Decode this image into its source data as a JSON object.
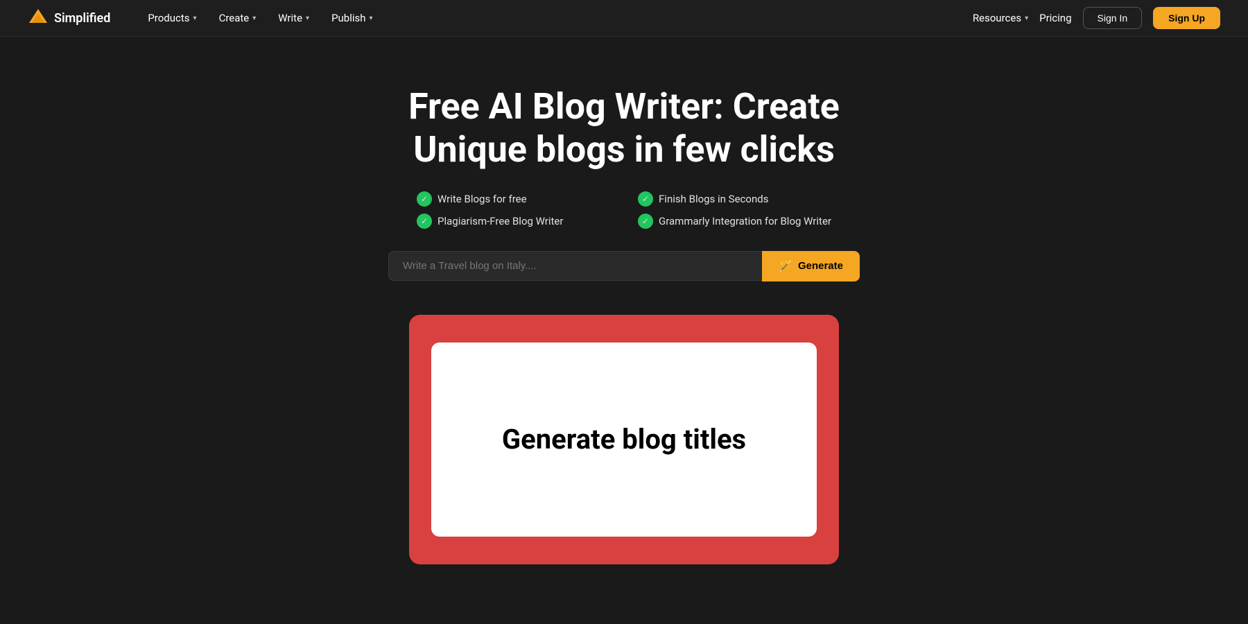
{
  "nav": {
    "logo": {
      "text": "Simplified"
    },
    "items": [
      {
        "label": "Products",
        "has_dropdown": true
      },
      {
        "label": "Create",
        "has_dropdown": true
      },
      {
        "label": "Write",
        "has_dropdown": true
      },
      {
        "label": "Publish",
        "has_dropdown": true
      }
    ],
    "right_items": [
      {
        "label": "Resources",
        "has_dropdown": true
      },
      {
        "label": "Pricing",
        "has_dropdown": false
      }
    ],
    "signin_label": "Sign In",
    "signup_label": "Sign Up"
  },
  "hero": {
    "title": "Free AI Blog Writer: Create Unique blogs in few clicks",
    "features": [
      "Write Blogs for free",
      "Finish Blogs in Seconds",
      "Plagiarism-Free Blog Writer",
      "Grammarly Integration for Blog Writer"
    ]
  },
  "search": {
    "placeholder": "Write a Travel blog on Italy....",
    "button_label": "Generate"
  },
  "card": {
    "text": "Generate blog titles"
  }
}
